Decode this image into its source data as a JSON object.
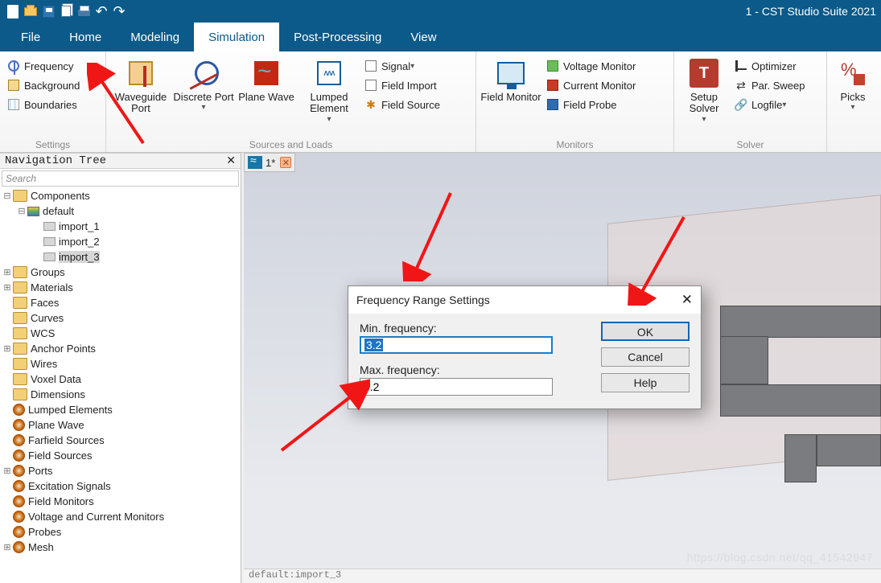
{
  "app": {
    "title": "1 - CST Studio Suite 2021"
  },
  "qat": {
    "undo": "↶",
    "redo": "↷"
  },
  "menu": {
    "tabs": [
      "File",
      "Home",
      "Modeling",
      "Simulation",
      "Post-Processing",
      "View"
    ],
    "active": "Simulation"
  },
  "ribbon": {
    "settings": {
      "label": "Settings",
      "frequency": "Frequency",
      "background": "Background",
      "boundaries": "Boundaries"
    },
    "sources": {
      "label": "Sources and Loads",
      "waveguide": "Waveguide Port",
      "discrete": "Discrete Port",
      "plane": "Plane Wave",
      "lumped": "Lumped Element",
      "signal": "Signal",
      "field_import": "Field Import",
      "field_source": "Field Source"
    },
    "monitors": {
      "label": "Monitors",
      "field_monitor": "Field Monitor",
      "voltage": "Voltage Monitor",
      "current": "Current Monitor",
      "probe": "Field Probe"
    },
    "solver": {
      "label": "Solver",
      "setup": "Setup Solver",
      "optimizer": "Optimizer",
      "par_sweep": "Par. Sweep",
      "logfile": "Logfile"
    },
    "picks": {
      "label": "Picks"
    }
  },
  "nav": {
    "title": "Navigation Tree",
    "search_placeholder": "Search",
    "items": {
      "components": "Components",
      "default": "default",
      "import1": "import_1",
      "import2": "import_2",
      "import3": "import_3",
      "groups": "Groups",
      "materials": "Materials",
      "faces": "Faces",
      "curves": "Curves",
      "wcs": "WCS",
      "anchor": "Anchor Points",
      "wires": "Wires",
      "voxel": "Voxel Data",
      "dimensions": "Dimensions",
      "lumped": "Lumped Elements",
      "planewave": "Plane Wave",
      "farfield": "Farfield Sources",
      "fieldsrc": "Field Sources",
      "ports": "Ports",
      "excitation": "Excitation Signals",
      "fieldmon": "Field Monitors",
      "vcimon": "Voltage and Current Monitors",
      "probes": "Probes",
      "mesh": "Mesh"
    }
  },
  "doctab": {
    "name": "1*"
  },
  "dialog": {
    "title": "Frequency Range Settings",
    "min_label": "Min. frequency:",
    "min_value": "3.2",
    "max_label": "Max. frequency:",
    "max_value": "5.2",
    "ok": "OK",
    "cancel": "Cancel",
    "help": "Help"
  },
  "status": "default:import_3",
  "watermark": "https://blog.csdn.net/qq_41542947"
}
